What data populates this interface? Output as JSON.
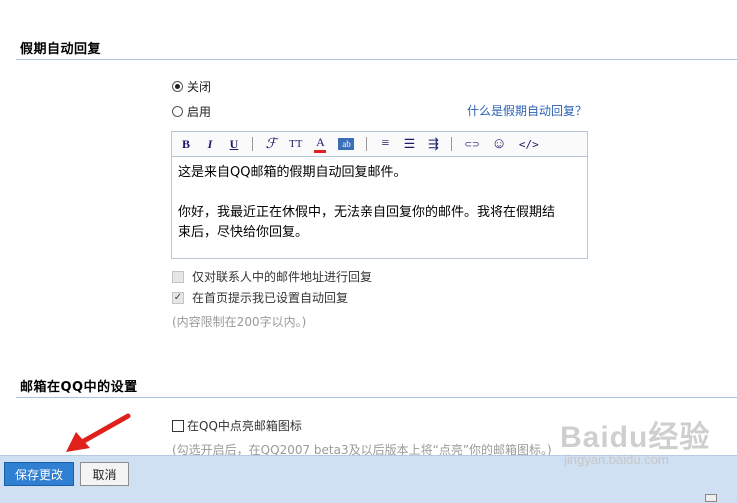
{
  "vacation": {
    "title": "假期自动回复",
    "radio_off_label": "关闭",
    "radio_on_label": "启用",
    "help_link": "什么是假期自动回复？",
    "editor": {
      "toolbar": {
        "bold": "B",
        "italic": "I",
        "underline": "U",
        "font": "ℱ",
        "size": "TT",
        "color": "A",
        "bgcolor": "ab",
        "align": "≡",
        "list": "☰",
        "indent": "⇶",
        "link": "⊂⊃",
        "emoji": "☺",
        "code": "</>"
      },
      "line1": "这是来自QQ邮箱的假期自动回复邮件。",
      "line2": "你好，我最近正在休假中，无法亲自回复你的邮件。我将在假期结",
      "line3": "束后，尽快给你回复。"
    },
    "contacts_only_label": "仅对联系人中的邮件地址进行回复",
    "homepage_notice_label": "在首页提示我已设置自动回复",
    "limit_hint": "(内容限制在200字以内。)"
  },
  "qq_settings": {
    "title": "邮箱在QQ中的设置",
    "light_icon_label": "在QQ中点亮邮箱图标",
    "light_icon_hint": "(勾选开启后，在QQ2007 beta3及以后版本上将“点亮”你的邮箱图标。)"
  },
  "actions": {
    "save_label": "保存更改",
    "cancel_label": "取消"
  },
  "watermark": {
    "main": "Baidu经验",
    "sub": "jingyan.baidu.com"
  },
  "colors": {
    "accent": "#2f7fd2",
    "link": "#2a62b6",
    "bottom_bar": "#cfe0f3",
    "annotation_arrow": "#e0201a"
  }
}
